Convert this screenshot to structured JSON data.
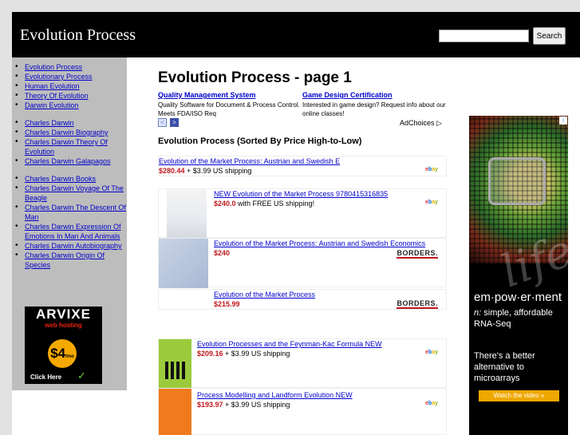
{
  "header": {
    "site_title": "Evolution Process",
    "search_placeholder": "",
    "search_button": "Search"
  },
  "sidebar": {
    "group1": [
      "Evolution Process",
      "Evolutionary Process",
      "Human Evolution",
      "Theory Of Evolution",
      "Darwin Evolution"
    ],
    "group2": [
      "Charles Darwin",
      "Charles Darwin Biography",
      "Charles Darwin Theory Of Evolution",
      "Charles Darwin Galapagos"
    ],
    "group3": [
      "Charles Darwin Books",
      "Charles Darwin Voyage Of The Beagle",
      "Charles Darwin The Descent Of Man",
      "Charles Darwin Expression Of Emotions In Man And Animals",
      "Charles Darwin Autobiography",
      "Charles Darwin Origin Of Species"
    ],
    "banner": {
      "logo": "ARVIXE",
      "sub": "web hosting",
      "price": "$4",
      "price_unit": "/mo",
      "cta": "Click Here"
    }
  },
  "main": {
    "title": "Evolution Process - page 1",
    "ads": [
      {
        "title": "Quality Management System",
        "text": "Quality Software for Document & Process Control. Meets FDA/ISO Req"
      },
      {
        "title": "Game Design Certification",
        "text": "Interested in game design? Request info about our online classes!"
      }
    ],
    "ad_prev": "<",
    "ad_next": ">",
    "adchoices": "AdChoices ▷",
    "section_heading": "Evolution Process (Sorted By Price High-to-Low)",
    "items": [
      {
        "title": "Evolution of the Market Process: Austrian and Swedish E",
        "price": "$280.44",
        "shipping": " + $3.99 US shipping",
        "store": "ebay"
      },
      {
        "title": "NEW Evolution of the Market Process 9780415316835",
        "price": "$240.0",
        "shipping": " with FREE US shipping!",
        "store": "ebay"
      },
      {
        "title": "Evolution of the Market Process: Austrian and Swedish Economics",
        "price": "$240",
        "shipping": "",
        "store": "BORDERS."
      },
      {
        "title": "Evolution of the Market Process",
        "price": "$215.99",
        "shipping": "",
        "store": "BORDERS."
      },
      {
        "title": "Evolution Processes and the Feynman-Kac Formula NEW",
        "price": "$209.16",
        "shipping": " + $3.99 US shipping",
        "store": "ebay"
      },
      {
        "title": "Process Modelling and Landform Evolution NEW",
        "price": "$193.97",
        "shipping": " + $3.99 US shipping",
        "store": "ebay"
      }
    ]
  },
  "sky_ad": {
    "word": "em·pow·er·ment",
    "definition_lead": "n:",
    "definition": " simple, affordable RNA-Seq",
    "alt": "There's a better alternative to microarrays",
    "button": "Watch the video »",
    "info": "i"
  },
  "colors": {
    "link": "#0000cc",
    "price": "#c0181d",
    "header_bg": "#000000",
    "sidebar_bg": "#bdbdbd"
  }
}
